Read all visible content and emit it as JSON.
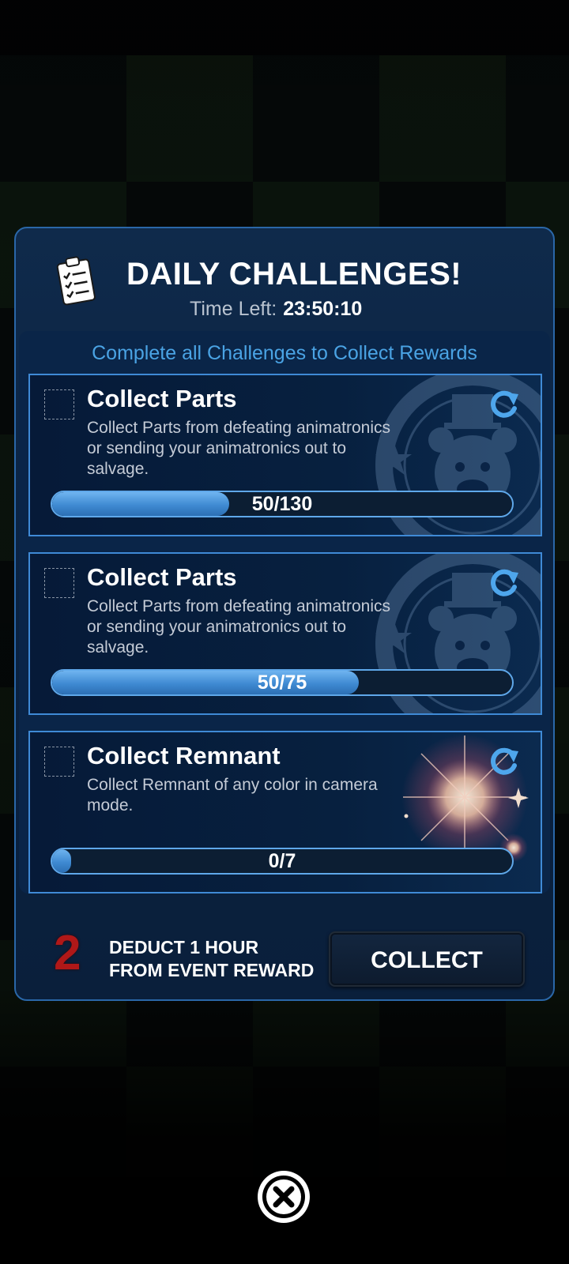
{
  "header": {
    "title": "DAILY CHALLENGES!",
    "time_left_label": "Time Left:",
    "time_left_value": "23:50:10",
    "icon": "clipboard-checklist-icon"
  },
  "subtitle": "Complete all Challenges to Collect Rewards",
  "challenges": [
    {
      "title": "Collect Parts",
      "description": "Collect Parts from defeating animatronics or sending your animatronics out to salvage.",
      "progress_text": "50/130",
      "progress_fraction": 0.385,
      "decoration": "freddy-badge",
      "refresh_icon": "refresh-icon"
    },
    {
      "title": "Collect Parts",
      "description": "Collect Parts from defeating animatronics or sending your animatronics out to salvage.",
      "progress_text": "50/75",
      "progress_fraction": 0.667,
      "decoration": "freddy-badge",
      "refresh_icon": "refresh-icon"
    },
    {
      "title": "Collect Remnant",
      "description": "Collect Remnant of any color in camera mode.",
      "progress_text": "0/7",
      "progress_fraction": 0.0,
      "decoration": "remnant-glow",
      "refresh_icon": "refresh-icon"
    }
  ],
  "reward": {
    "amount": "2",
    "line1": "DEDUCT 1 HOUR",
    "line2": "FROM EVENT REWARD"
  },
  "collect_label": "COLLECT",
  "close_icon": "close-icon",
  "colors": {
    "accent": "#3f8ad6",
    "subtitle": "#4aa3e4",
    "reward_red": "#b01818",
    "panel": "#0f2a4b"
  }
}
